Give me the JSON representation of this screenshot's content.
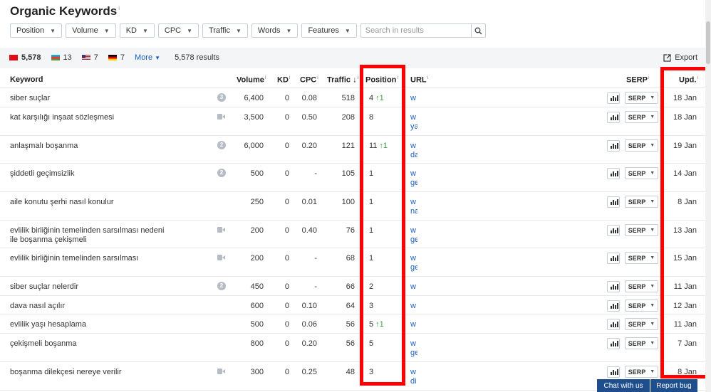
{
  "header": {
    "title": "Organic Keywords",
    "info_mark": "i",
    "filters": [
      {
        "label": "Position"
      },
      {
        "label": "Volume"
      },
      {
        "label": "KD"
      },
      {
        "label": "CPC"
      },
      {
        "label": "Traffic"
      },
      {
        "label": "Words"
      },
      {
        "label": "Features"
      }
    ],
    "search": {
      "placeholder": "Search in results",
      "icon": "search-icon"
    }
  },
  "summary": {
    "countries": [
      {
        "flag": "tr",
        "count": "5,578",
        "bold": true
      },
      {
        "flag": "az",
        "count": "13"
      },
      {
        "flag": "us",
        "count": "7"
      },
      {
        "flag": "de",
        "count": "7"
      }
    ],
    "more_label": "More",
    "results_label": "5,578 results",
    "export_label": "Export"
  },
  "columns": {
    "keyword": "Keyword",
    "volume": "Volume",
    "kd": "KD",
    "cpc": "CPC",
    "traffic": "Traffic",
    "sort_arrow": "↓",
    "position": "Position",
    "url": "URL",
    "serp": "SERP",
    "updated": "Upd.",
    "info_mark": "i"
  },
  "rows": [
    {
      "keyword": "siber suçlar",
      "feature": "badge",
      "feature_count": "3",
      "volume": "6,400",
      "kd": "0",
      "cpc": "0.08",
      "traffic": "518",
      "position": "4",
      "change": "↑1",
      "url": [
        "w"
      ],
      "updated": "18 Jan"
    },
    {
      "keyword": "kat karşılığı inşaat sözleşmesi",
      "feature": "video",
      "volume": "3,500",
      "kd": "0",
      "cpc": "0.50",
      "traffic": "208",
      "position": "8",
      "change": "",
      "url": [
        "w",
        "ya"
      ],
      "updated": "18 Jan"
    },
    {
      "keyword": "anlaşmalı boşanma",
      "feature": "badge",
      "feature_count": "2",
      "volume": "6,000",
      "kd": "0",
      "cpc": "0.20",
      "traffic": "121",
      "position": "11",
      "change": "↑1",
      "url": [
        "w",
        "da"
      ],
      "updated": "19 Jan"
    },
    {
      "keyword": "şiddetli geçimsizlik",
      "feature": "badge",
      "feature_count": "2",
      "volume": "500",
      "kd": "0",
      "cpc": "-",
      "traffic": "105",
      "position": "1",
      "change": "",
      "url": [
        "w",
        "ge"
      ],
      "updated": "14 Jan"
    },
    {
      "keyword": "aile konutu şerhi nasıl konulur",
      "feature": "",
      "volume": "250",
      "kd": "0",
      "cpc": "0.01",
      "traffic": "100",
      "position": "1",
      "change": "",
      "url": [
        "w",
        "na"
      ],
      "updated": "8 Jan"
    },
    {
      "keyword": "evlilik birliğinin temelinden sarsılması nedeni ile boşanma çekişmeli",
      "feature": "video",
      "volume": "200",
      "kd": "0",
      "cpc": "0.40",
      "traffic": "76",
      "position": "1",
      "change": "",
      "url": [
        "w",
        "ge"
      ],
      "updated": "13 Jan"
    },
    {
      "keyword": "evlilik birliğinin temelinden sarsılması",
      "feature": "video",
      "volume": "200",
      "kd": "0",
      "cpc": "-",
      "traffic": "68",
      "position": "1",
      "change": "",
      "url": [
        "w",
        "ge"
      ],
      "updated": "15 Jan"
    },
    {
      "keyword": "siber suçlar nelerdir",
      "feature": "badge",
      "feature_count": "2",
      "volume": "450",
      "kd": "0",
      "cpc": "-",
      "traffic": "66",
      "position": "2",
      "change": "",
      "url": [
        "w"
      ],
      "updated": "11 Jan"
    },
    {
      "keyword": "dava nasıl açılır",
      "feature": "",
      "volume": "600",
      "kd": "0",
      "cpc": "0.10",
      "traffic": "64",
      "position": "3",
      "change": "",
      "url": [
        "w"
      ],
      "updated": "12 Jan"
    },
    {
      "keyword": "evlilik yaşı hesaplama",
      "feature": "",
      "volume": "500",
      "kd": "0",
      "cpc": "0.06",
      "traffic": "56",
      "position": "5",
      "change": "↑1",
      "url": [
        "w"
      ],
      "updated": "11 Jan"
    },
    {
      "keyword": "çekişmeli boşanma",
      "feature": "",
      "volume": "800",
      "kd": "0",
      "cpc": "0.20",
      "traffic": "56",
      "position": "5",
      "change": "",
      "url": [
        "w",
        "ge"
      ],
      "updated": "7 Jan"
    },
    {
      "keyword": "boşanma dilekçesi nereye verilir",
      "feature": "video",
      "volume": "300",
      "kd": "0",
      "cpc": "0.25",
      "traffic": "48",
      "position": "3",
      "change": "",
      "url": [
        "w",
        "di"
      ],
      "updated": "8 Jan"
    }
  ],
  "serp_button_label": "SERP",
  "footer": {
    "chat_label": "Chat with us",
    "bug_label": "Report bug"
  },
  "colors": {
    "link": "#1b5fbb",
    "highlight": "#ff0000",
    "footer_button": "#1f4e8c",
    "up_arrow": "#3a9d3a"
  }
}
